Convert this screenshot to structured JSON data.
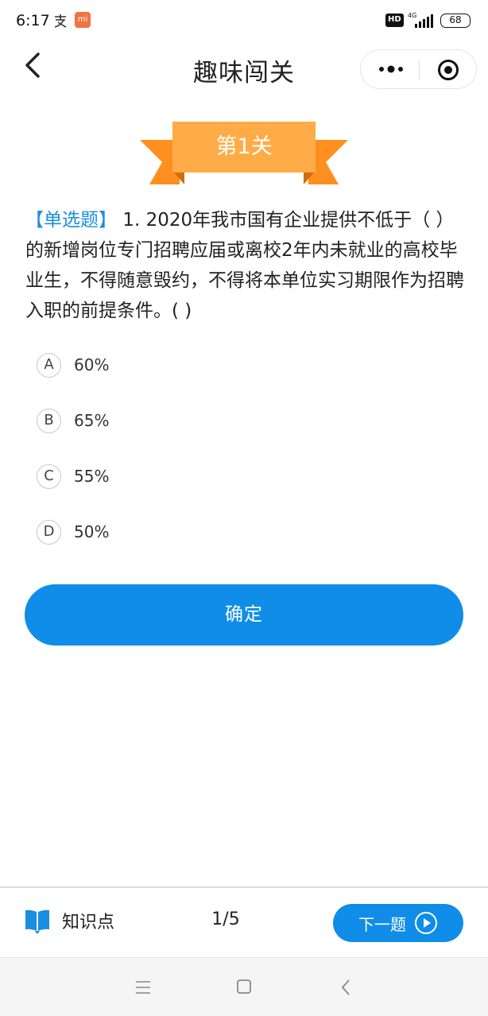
{
  "status_bar": {
    "time": "6:17",
    "hd": "HD",
    "network": "4G",
    "battery": "68",
    "app_icon_2_text": "mi"
  },
  "nav": {
    "title": "趣味闯关",
    "back_icon": "chevron-left-icon",
    "more_icon": "more-dots-icon",
    "close_icon": "target-circle-icon"
  },
  "level": {
    "label": "第1关",
    "ribbon_color": "#ff9a2e",
    "banner_color": "#ffab47"
  },
  "question": {
    "type": "【单选题】",
    "text": " 1. 2020年我市国有企业提供不低于（ ）的新增岗位专门招聘应届或离校2年内未就业的高校毕业生，不得随意毁约，不得将本单位实习期限作为招聘入职的前提条件。( )"
  },
  "options": [
    {
      "letter": "A",
      "text": "60%"
    },
    {
      "letter": "B",
      "text": "65%"
    },
    {
      "letter": "C",
      "text": "55%"
    },
    {
      "letter": "D",
      "text": "50%"
    }
  ],
  "confirm_button": {
    "label": "确定"
  },
  "bottom": {
    "knowledge_label": "知识点",
    "knowledge_icon": "book-icon",
    "progress": "1/5",
    "next_label": "下一题",
    "next_icon": "play-circle-icon"
  },
  "colors": {
    "accent": "#0f8de8",
    "question_type": "#1a8ee0"
  }
}
